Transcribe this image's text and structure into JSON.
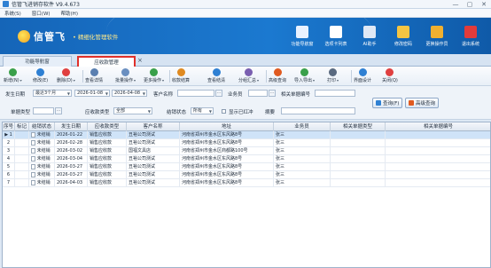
{
  "window": {
    "title": "信管飞进销存软件 V9.4.673",
    "controls": [
      "—",
      "▢",
      "✕"
    ]
  },
  "menu": [
    "系统(S)",
    "窗口(W)",
    "帮助(H)"
  ],
  "banner": {
    "brand": "信管飞",
    "slogan": "• 精细化管理软件"
  },
  "topnav": [
    {
      "label": "功能导航窗",
      "icon": "monitor-icon",
      "color": "#e9f2ff"
    },
    {
      "label": "选项卡列表",
      "icon": "list-window-icon",
      "color": "#ffffff"
    },
    {
      "label": "AI助手",
      "icon": "robot-icon",
      "color": "#dfe8f5"
    },
    {
      "label": "修改密码",
      "icon": "lock-icon",
      "color": "#f5c542"
    },
    {
      "label": "更换操作员",
      "icon": "user-icon",
      "color": "#f0b030"
    },
    {
      "label": "退出系统",
      "icon": "close-circle-icon",
      "color": "#e23b3b"
    }
  ],
  "tabs": {
    "nav": "功能导航窗",
    "active": "应收款管理"
  },
  "toolbar": [
    {
      "label": "新增(N)",
      "icon": "plus-icon",
      "color": "#3aa04a",
      "dropdown": true
    },
    {
      "label": "修改(E)",
      "icon": "edit-icon",
      "color": "#2f80d3",
      "dropdown": false
    },
    {
      "label": "删除(D)",
      "icon": "delete-icon",
      "color": "#e04040",
      "dropdown": true
    },
    {
      "label": "查看详情",
      "icon": "detail-icon",
      "color": "#5a7fb0",
      "dropdown": false
    },
    {
      "label": "批量操作",
      "icon": "batch-icon",
      "color": "#6a8fc0",
      "dropdown": true
    },
    {
      "label": "更多操作",
      "icon": "more-icon",
      "color": "#3aa04a",
      "dropdown": true
    },
    {
      "label": "收款结算",
      "icon": "settle-icon",
      "color": "#e08a20",
      "dropdown": false
    },
    {
      "label": "查看结清",
      "icon": "view-icon",
      "color": "#2f80d3",
      "dropdown": false
    },
    {
      "label": "分组汇总",
      "icon": "group-icon",
      "color": "#7a5fb0",
      "dropdown": true
    },
    {
      "label": "高级查询",
      "icon": "query-icon",
      "color": "#e05a20",
      "dropdown": false
    },
    {
      "label": "导入导出",
      "icon": "import-export-icon",
      "color": "#3aa04a",
      "dropdown": true
    },
    {
      "label": "打印",
      "icon": "print-icon",
      "color": "#5a6a80",
      "dropdown": true
    },
    {
      "label": "界面设计",
      "icon": "design-icon",
      "color": "#2f80d3",
      "dropdown": false
    },
    {
      "label": "关闭(Q)",
      "icon": "close-icon",
      "color": "#e04040",
      "dropdown": false
    }
  ],
  "filters": {
    "date_label": "发生日期",
    "date_range": "最近3个月",
    "date_from": "2026-01-08",
    "date_to": "2026-04-08",
    "customer_label": "客户名称",
    "customer_value": "",
    "salesman_label": "业务员",
    "salesman_value": "",
    "ref_no_label": "相关单据编号",
    "ref_no_value": "",
    "doc_type_label": "单据类型",
    "doc_type_value": "",
    "receivable_type_label": "应收款类型",
    "receivable_type_value": "全部",
    "settle_status_label": "结销状态",
    "settle_status_value": "所有",
    "show_red_label": "显示已红冲",
    "summary_label": "摘要",
    "summary_value": "",
    "query_button": "查询(F)",
    "advanced_query_button": "高级查询"
  },
  "grid": {
    "columns": [
      "序号",
      "标记",
      "结销状态",
      "发生日期",
      "应收款类型",
      "客户名称",
      "地址",
      "业务员",
      "相关单据类型",
      "相关单据编号"
    ],
    "rows": [
      {
        "no": "1",
        "status": "未结销",
        "date": "2026-01-22",
        "type": "销售应收款",
        "customer": "丑裕公司测试",
        "address": "河南省郑州市金水区东风路8号",
        "salesman": "张三",
        "selected": true
      },
      {
        "no": "2",
        "status": "未结销",
        "date": "2026-02-28",
        "type": "销售应收款",
        "customer": "丑裕公司测试",
        "address": "河南省郑州市金水区东风路8号",
        "salesman": "张三",
        "selected": false
      },
      {
        "no": "3",
        "status": "未结销",
        "date": "2026-03-02",
        "type": "销售应收款",
        "customer": "国福文具店",
        "address": "河南省郑州市金水区商都路100号",
        "salesman": "张三",
        "selected": false
      },
      {
        "no": "4",
        "status": "未结销",
        "date": "2026-03-04",
        "type": "销售应收款",
        "customer": "丑裕公司测试",
        "address": "河南省郑州市金水区东风路8号",
        "salesman": "张三",
        "selected": false
      },
      {
        "no": "5",
        "status": "未结销",
        "date": "2026-03-27",
        "type": "销售应收款",
        "customer": "丑裕公司测试",
        "address": "河南省郑州市金水区东风路8号",
        "salesman": "张三",
        "selected": false
      },
      {
        "no": "6",
        "status": "未结销",
        "date": "2026-03-27",
        "type": "销售应收款",
        "customer": "丑裕公司测试",
        "address": "河南省郑州市金水区东风路8号",
        "salesman": "张三",
        "selected": false
      },
      {
        "no": "7",
        "status": "未结销",
        "date": "2026-04-03",
        "type": "销售应收款",
        "customer": "丑裕公司测试",
        "address": "河南省郑州市金水区东风路8号",
        "salesman": "张三",
        "selected": false
      }
    ]
  }
}
